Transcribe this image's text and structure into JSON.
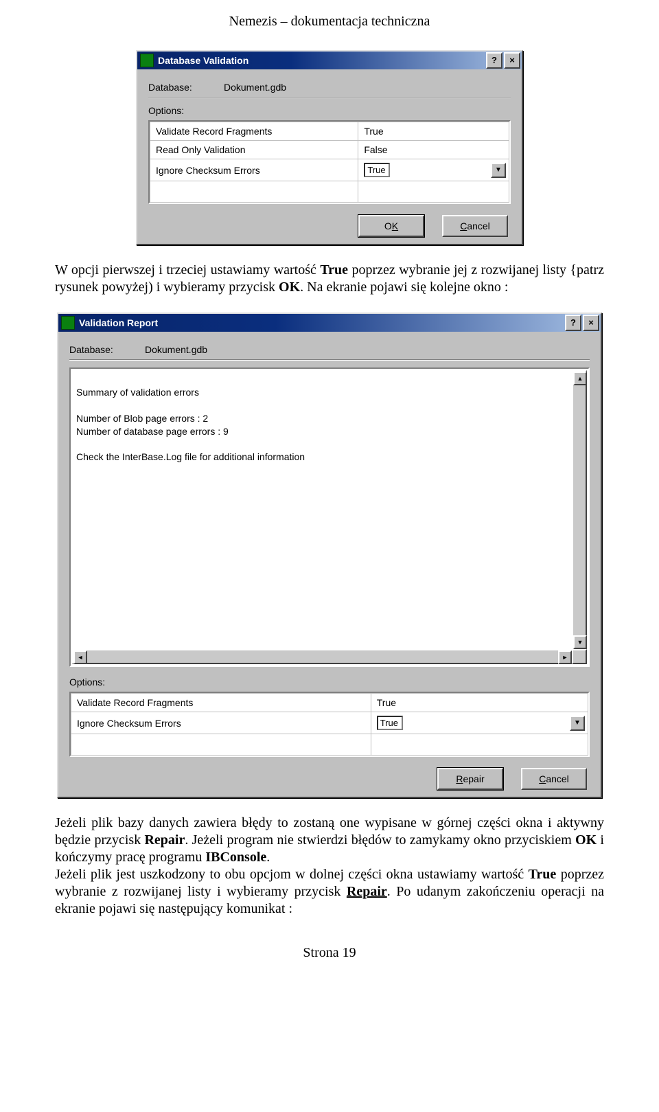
{
  "doc": {
    "header": "Nemezis – dokumentacja techniczna",
    "para1_a": "W opcji pierwszej i trzeciej ustawiamy wartość ",
    "para1_b_bold": "True",
    "para1_c": " poprzez wybranie jej z rozwijanej listy {patrz rysunek powyżej) i wybieramy przycisk ",
    "para1_d_bold": "OK",
    "para1_e": ". Na ekranie pojawi się kolejne okno :",
    "para2_a": "Jeżeli plik bazy danych zawiera błędy to zostaną one wypisane w górnej części okna i aktywny będzie przycisk ",
    "para2_b_bold": "Repair",
    "para2_c": ". Jeżeli program nie stwierdzi błędów to zamykamy okno przyciskiem ",
    "para2_d_bold": "OK",
    "para2_e": " i kończymy pracę programu ",
    "para2_f_bold": "IBConsole",
    "para2_g": ".",
    "para3_a": "Jeżeli plik jest uszkodzony to obu opcjom  w dolnej części okna ustawiamy wartość ",
    "para3_b_bold": "True",
    "para3_c": " poprzez wybranie z rozwijanej listy i wybieramy przycisk ",
    "para3_d_bu": "Repair",
    "para3_e": ". Po udanym zakończeniu operacji na ekranie pojawi się następujący komunikat :",
    "footer": "Strona 19"
  },
  "dlg1": {
    "title": "Database Validation",
    "database_label": "Database:",
    "database_value": "Dokument.gdb",
    "options_label": "Options:",
    "rows": [
      {
        "name": "Validate Record Fragments",
        "value": "True"
      },
      {
        "name": "Read Only Validation",
        "value": "False"
      },
      {
        "name": "Ignore Checksum Errors",
        "value": "True"
      }
    ],
    "ok_pre": "O",
    "ok_u": "K",
    "cancel_u": "C",
    "cancel_post": "ancel"
  },
  "dlg2": {
    "title": "Validation Report",
    "database_label": "Database:",
    "database_value": "Dokument.gdb",
    "report_text": "Summary of validation errors\n\nNumber of Blob page errors      : 2\nNumber of database page errors           : 9\n\nCheck the InterBase.Log file for additional information",
    "options_label": "Options:",
    "rows": [
      {
        "name": "Validate Record Fragments",
        "value": "True"
      },
      {
        "name": "Ignore Checksum Errors",
        "value": "True"
      }
    ],
    "repair_u": "R",
    "repair_post": "epair",
    "cancel_u": "C",
    "cancel_post": "ancel"
  }
}
